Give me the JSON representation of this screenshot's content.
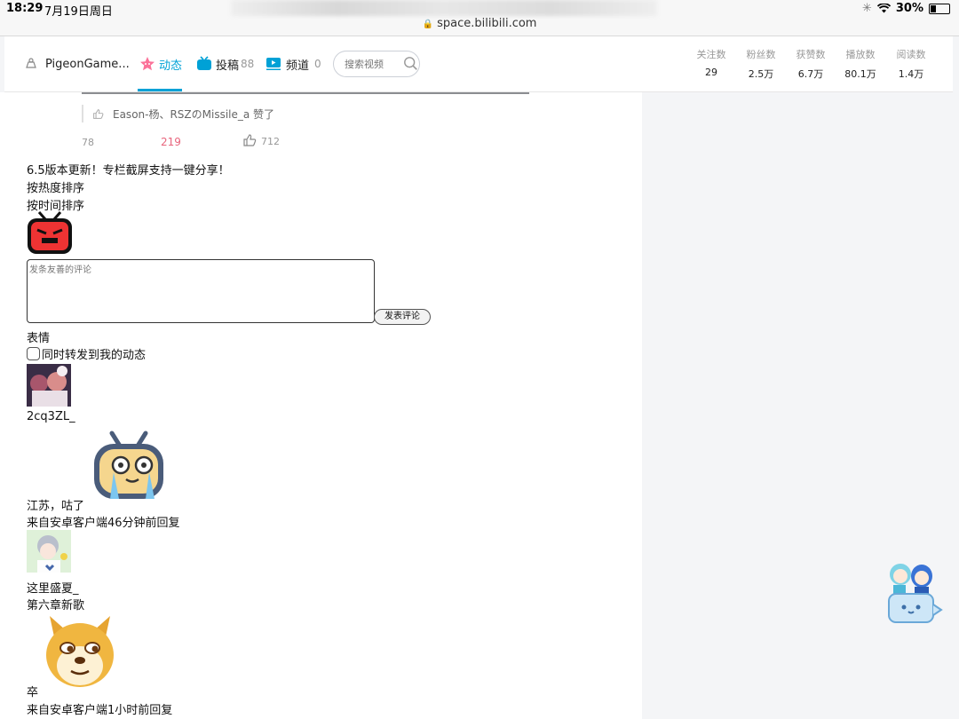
{
  "status": {
    "time": "18:29",
    "date": "7月19日周日",
    "url": "space.bilibili.com",
    "battery": "30%"
  },
  "nav": {
    "username": "PigeonGame...",
    "tab_dynamic": "动态",
    "tab_post": "投稿",
    "post_count": "88",
    "tab_channel": "频道",
    "channel_count": "0",
    "search_placeholder": "搜索视频"
  },
  "stats": [
    {
      "label": "关注数",
      "value": "29"
    },
    {
      "label": "粉丝数",
      "value": "2.5万"
    },
    {
      "label": "获赞数",
      "value": "6.7万"
    },
    {
      "label": "播放数",
      "value": "80.1万"
    },
    {
      "label": "阅读数",
      "value": "1.4万"
    }
  ],
  "post": {
    "liked_by": "Eason-杨、RSZのMissile_a 赞了",
    "forwards": "78",
    "comments": "219",
    "likes": "712"
  },
  "comments_section": {
    "notice": "6.5版本更新！专栏截屏支持一键分享！",
    "sort_hot": "按热度排序",
    "sort_time": "按时间排序",
    "comment_placeholder": "发条友善的评论",
    "send_label": "发表评论",
    "emoji_label": "表情",
    "forward_label": "同时转发到我的动态"
  },
  "comments": [
    {
      "user": "2cq3ZL_",
      "text": "江苏，咕了",
      "meta": "来自安卓客户端46分钟前回复"
    },
    {
      "user": "这里盛夏_",
      "text": "第六章新歌",
      "meta": ""
    },
    {
      "user": "",
      "text": "卒",
      "meta": "来自安卓客户端1小时前回复"
    }
  ],
  "colors": {
    "accent": "#00a1d6",
    "pink": "#fb7299",
    "comment_count": "#e8657d"
  }
}
